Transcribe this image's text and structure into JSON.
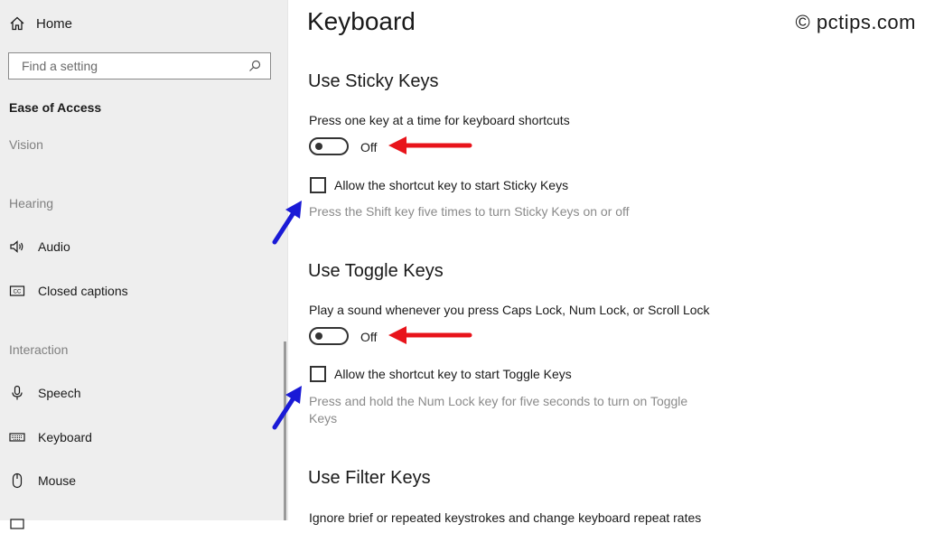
{
  "sidebar": {
    "home_label": "Home",
    "search_placeholder": "Find a setting",
    "section_title": "Ease of Access",
    "groups": {
      "vision": "Vision",
      "hearing": "Hearing",
      "interaction": "Interaction"
    },
    "items": {
      "audio": "Audio",
      "closed_captions": "Closed captions",
      "speech": "Speech",
      "keyboard": "Keyboard",
      "mouse": "Mouse"
    }
  },
  "main": {
    "title": "Keyboard",
    "watermark": "© pctips.com",
    "sticky": {
      "heading": "Use Sticky Keys",
      "description": "Press one key at a time for keyboard shortcuts",
      "toggle_state": "Off",
      "checkbox_label": "Allow the shortcut key to start Sticky Keys",
      "help": "Press the Shift key five times to turn Sticky Keys on or off"
    },
    "toggle_keys": {
      "heading": "Use Toggle Keys",
      "description": "Play a sound whenever you press Caps Lock, Num Lock, or Scroll Lock",
      "toggle_state": "Off",
      "checkbox_label": "Allow the shortcut key to start Toggle Keys",
      "help": "Press and hold the Num Lock key for five seconds to turn on Toggle Keys"
    },
    "filter": {
      "heading": "Use Filter Keys",
      "description": "Ignore brief or repeated keystrokes and change keyboard repeat rates"
    }
  },
  "colors": {
    "annotation_red": "#e8141b",
    "annotation_blue": "#1a1ad6",
    "sidebar_bg": "#eeeeee"
  }
}
